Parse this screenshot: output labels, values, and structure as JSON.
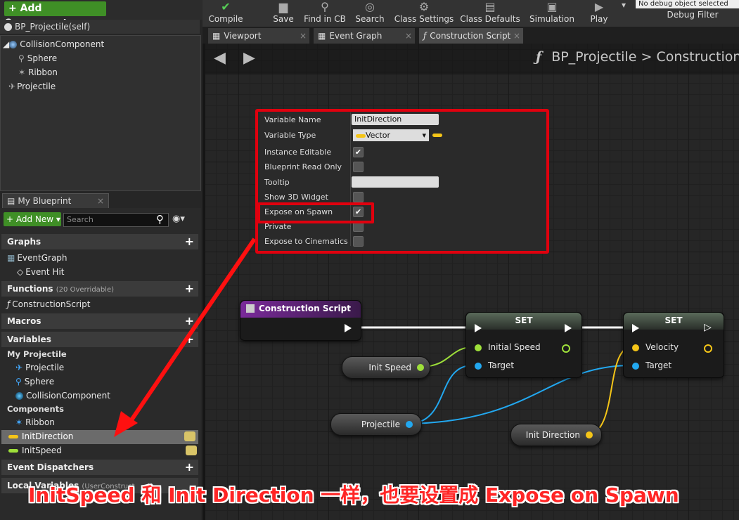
{
  "components": {
    "add_label": "+ Add Component",
    "self_label": "BP_Projectile(self)",
    "tree": [
      "CollisionComponent",
      "Sphere",
      "Ribbon",
      "Projectile"
    ]
  },
  "my_blueprint": {
    "tab": "My Blueprint",
    "add_new": "+ Add New",
    "search_placeholder": "Search",
    "graphs": {
      "label": "Graphs",
      "items": [
        "EventGraph",
        "Event Hit"
      ]
    },
    "functions": {
      "label": "Functions",
      "note": "(20 Overridable)",
      "items": [
        "ConstructionScript"
      ]
    },
    "macros": {
      "label": "Macros"
    },
    "variables": {
      "label": "Variables",
      "group1": "My Projectile",
      "group1_items": [
        "Projectile",
        "Sphere",
        "CollisionComponent"
      ],
      "group2": "Components",
      "group2_items": [
        "Ribbon",
        "InitDirection",
        "InitSpeed"
      ]
    },
    "event_dispatchers": {
      "label": "Event Dispatchers"
    },
    "local_variables": {
      "label": "Local Variables",
      "note": "(UserConstruct"
    }
  },
  "toolbar": {
    "compile": "Compile",
    "save": "Save",
    "find_in_cb": "Find in CB",
    "search": "Search",
    "class_settings": "Class Settings",
    "class_defaults": "Class Defaults",
    "simulation": "Simulation",
    "play": "Play",
    "debug_value": "No debug object selected",
    "debug_filter": "Debug Filter"
  },
  "tabs": [
    "Viewport",
    "Event Graph",
    "Construction Script"
  ],
  "breadcrumb": {
    "blueprint": "BP_Projectile",
    "sep": ">",
    "graph": "Construction"
  },
  "details": {
    "rows": [
      {
        "key": "Variable Name",
        "value": "InitDirection"
      },
      {
        "key": "Variable Type",
        "value": "Vector"
      },
      {
        "key": "Instance Editable",
        "value": "✔"
      },
      {
        "key": "Blueprint Read Only",
        "value": ""
      },
      {
        "key": "Tooltip",
        "value": ""
      },
      {
        "key": "Show 3D Widget",
        "value": ""
      },
      {
        "key": "Expose on Spawn",
        "value": "✔"
      },
      {
        "key": "Private",
        "value": ""
      },
      {
        "key": "Expose to Cinematics",
        "value": ""
      }
    ]
  },
  "nodes": {
    "construction": "Construction Script",
    "set1": {
      "title": "SET",
      "pin1": "Initial Speed",
      "pin2": "Target"
    },
    "set2": {
      "title": "SET",
      "pin1": "Velocity",
      "pin2": "Target"
    },
    "init_speed": "Init Speed",
    "projectile": "Projectile",
    "init_direction": "Init Direction"
  },
  "caption": "InitSpeed 和 Init Direction 一样，也要设置成 Expose on Spawn",
  "colors": {
    "accent_red": "#e0000e",
    "add_green": "#3f8f26",
    "vector_pin": "#f5c518",
    "float_pin": "#9ee03a",
    "object_pin": "#22a8f0"
  }
}
